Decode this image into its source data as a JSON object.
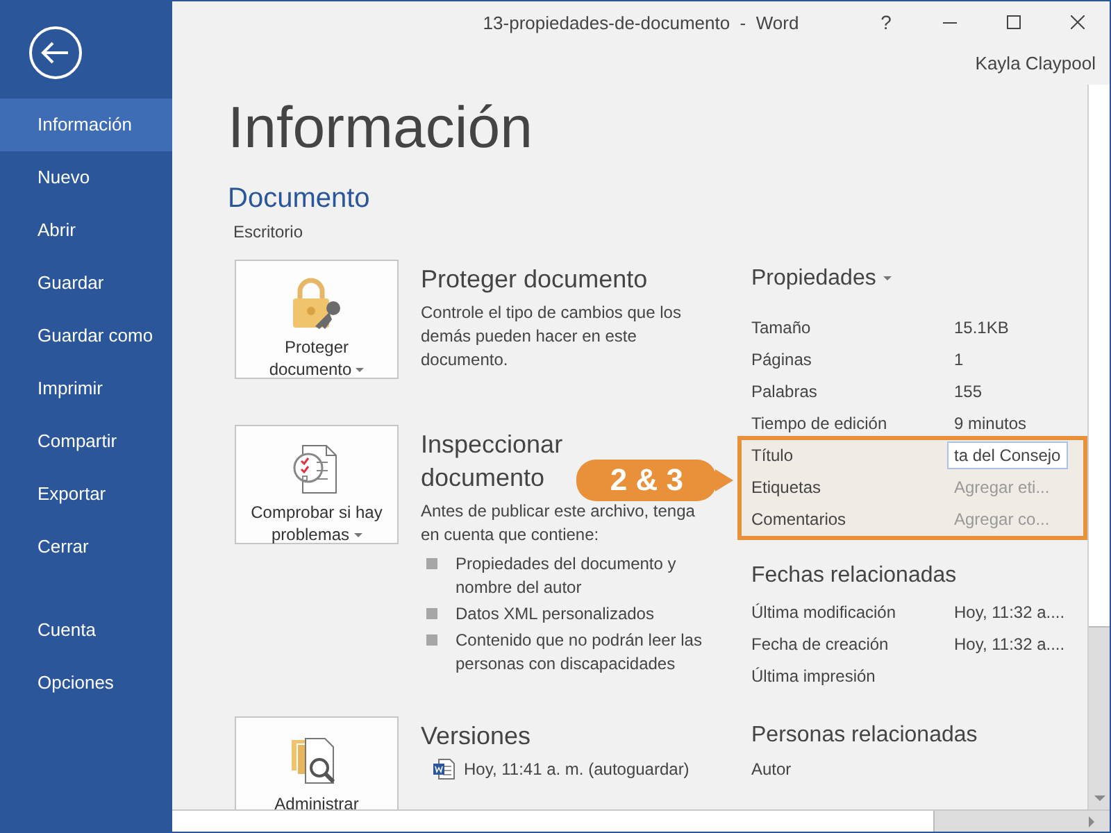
{
  "window": {
    "title": "13-propiedades-de-documento  -  Word",
    "help": "?",
    "user": "Kayla Claypool"
  },
  "sidebar": {
    "items": [
      {
        "label": "Información",
        "selected": true
      },
      {
        "label": "Nuevo",
        "selected": false
      },
      {
        "label": "Abrir",
        "selected": false
      },
      {
        "label": "Guardar",
        "selected": false
      },
      {
        "label": "Guardar como",
        "selected": false
      },
      {
        "label": "Imprimir",
        "selected": false
      },
      {
        "label": "Compartir",
        "selected": false
      },
      {
        "label": "Exportar",
        "selected": false
      },
      {
        "label": "Cerrar",
        "selected": false
      }
    ],
    "bottom_items": [
      {
        "label": "Cuenta",
        "selected": false
      },
      {
        "label": "Opciones",
        "selected": false
      }
    ]
  },
  "page": {
    "heading": "Información",
    "document": "Documento",
    "location": "Escritorio"
  },
  "sections": [
    {
      "kind": "protect",
      "button": "Proteger documento",
      "dropdown": true,
      "title": "Proteger documento",
      "text": "Controle el tipo de cambios que los demás pueden hacer en este documento."
    },
    {
      "kind": "inspect",
      "button": "Comprobar si hay problemas",
      "dropdown": true,
      "title": "Inspeccionar documento",
      "text": "Antes de publicar este archivo, tenga en cuenta que contiene:",
      "bullets": [
        "Propiedades del documento y nombre del autor",
        "Datos XML personalizados",
        "Contenido que no podrán leer las personas con discapacidades"
      ]
    },
    {
      "kind": "versions",
      "button": "Administrar",
      "dropdown": false,
      "title": "Versiones",
      "versions": [
        "Hoy, 11:41 a. m. (autoguardar)"
      ]
    }
  ],
  "properties": {
    "heading": "Propiedades",
    "dropdown": true,
    "rows": [
      {
        "label": "Tamaño",
        "value": "15.1KB",
        "kind": "value",
        "highlighted": false
      },
      {
        "label": "Páginas",
        "value": "1",
        "kind": "value",
        "highlighted": false
      },
      {
        "label": "Palabras",
        "value": "155",
        "kind": "value",
        "highlighted": false
      },
      {
        "label": "Tiempo de edición",
        "value": "9 minutos",
        "kind": "value",
        "highlighted": false
      },
      {
        "label": "Título",
        "value": "ta del Consejo",
        "kind": "field",
        "highlighted": true
      },
      {
        "label": "Etiquetas",
        "placeholder": "Agregar eti...",
        "kind": "hint",
        "highlighted": true
      },
      {
        "label": "Comentarios",
        "placeholder": "Agregar co...",
        "kind": "hint",
        "highlighted": true
      }
    ]
  },
  "related_dates": {
    "heading": "Fechas relacionadas",
    "rows": [
      {
        "label": "Última modificación",
        "value": "Hoy, 11:32 a...."
      },
      {
        "label": "Fecha de creación",
        "value": "Hoy, 11:32 a...."
      },
      {
        "label": "Última impresión"
      }
    ]
  },
  "related_people": {
    "heading": "Personas relacionadas",
    "rows": [
      {
        "label": "Autor"
      }
    ]
  },
  "callout": {
    "text": "2 & 3"
  }
}
